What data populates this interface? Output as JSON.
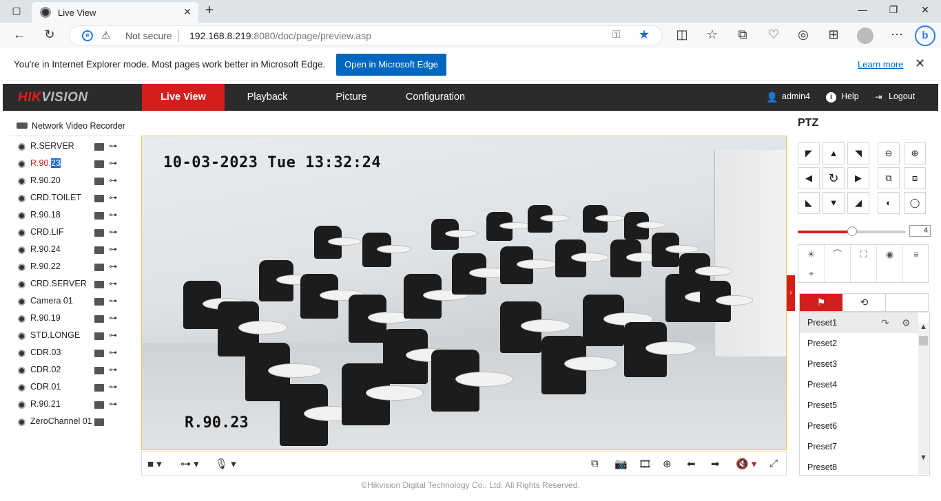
{
  "browser": {
    "tab_title": "Live View",
    "not_secure": "Not secure",
    "url_host": "192.168.8.219",
    "url_rest": ":8080/doc/page/preview.asp"
  },
  "ie_banner": {
    "message": "You're in Internet Explorer mode. Most pages work better in Microsoft Edge.",
    "open_button": "Open in Microsoft Edge",
    "learn_more": "Learn more"
  },
  "app": {
    "logo_hik": "HIK",
    "logo_vision": "VISION",
    "tabs": [
      "Live View",
      "Playback",
      "Picture",
      "Configuration"
    ],
    "user": "admin4",
    "help": "Help",
    "logout": "Logout"
  },
  "tree": {
    "root": "Network Video Recorder",
    "cameras": [
      {
        "name": "R.SERVER"
      },
      {
        "name": "R.90.",
        "highlight": "23",
        "active": true
      },
      {
        "name": "R.90.20"
      },
      {
        "name": "CRD.TOILET"
      },
      {
        "name": "R.90.18"
      },
      {
        "name": "CRD.LIF"
      },
      {
        "name": "R.90.24"
      },
      {
        "name": "R.90.22"
      },
      {
        "name": "CRD.SERVER"
      },
      {
        "name": "Camera 01"
      },
      {
        "name": "R.90.19"
      },
      {
        "name": "STD.LONGE"
      },
      {
        "name": "CDR.03"
      },
      {
        "name": "CDR.02"
      },
      {
        "name": "CDR.01"
      },
      {
        "name": "R.90.21"
      },
      {
        "name": "ZeroChannel 01"
      }
    ]
  },
  "video": {
    "osd_time": "10-03-2023 Tue 13:32:24",
    "osd_name": "R.90.23"
  },
  "ptz": {
    "title": "PTZ",
    "speed": "4",
    "speed_fraction": 0.5,
    "presets": [
      "Preset1",
      "Preset2",
      "Preset3",
      "Preset4",
      "Preset5",
      "Preset6",
      "Preset7",
      "Preset8"
    ]
  },
  "footer": "©Hikvision Digital Technology Co., Ltd. All Rights Reserved.",
  "colors": {
    "accent": "#d41e1e",
    "header_bg": "#2b2b2b",
    "edge_blue": "#0067c0"
  }
}
